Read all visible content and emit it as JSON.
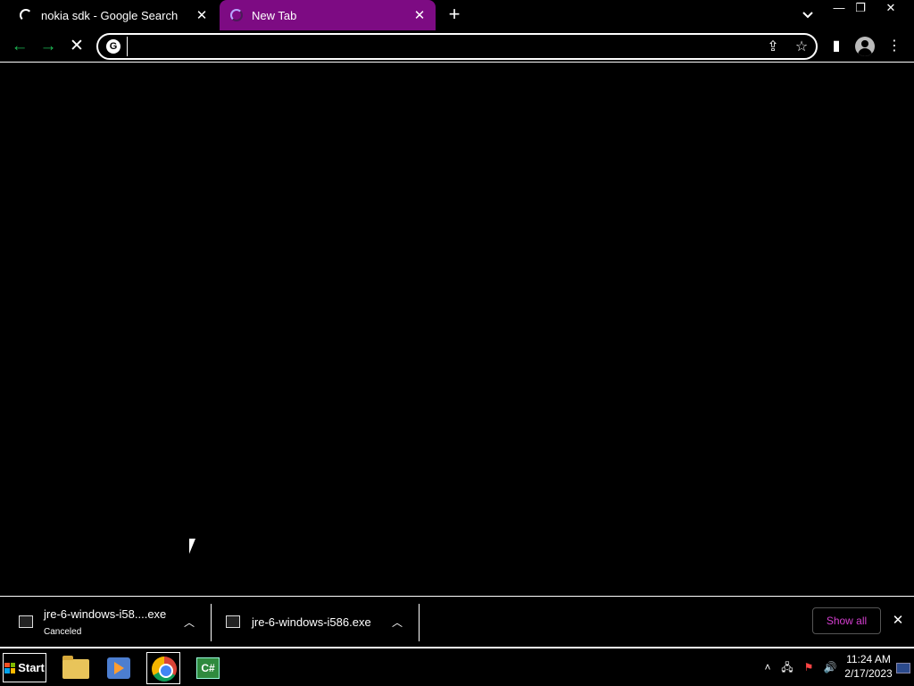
{
  "tabs": [
    {
      "title": "nokia sdk - Google Search",
      "active": false
    },
    {
      "title": "New Tab",
      "active": true
    }
  ],
  "omnibox": {
    "value": "",
    "placeholder": ""
  },
  "downloads": [
    {
      "filename": "jre-6-windows-i58....exe",
      "status": "Canceled"
    },
    {
      "filename": "jre-6-windows-i586.exe",
      "status": ""
    }
  ],
  "download_shelf": {
    "show_all_label": "Show all"
  },
  "taskbar": {
    "start_label": "Start",
    "apps": [
      "folder-icon",
      "media-player-icon",
      "chrome-icon",
      "csharp-icon"
    ],
    "clock_time": "11:24 AM",
    "clock_date": "2/17/2023",
    "csharp_label": "C#"
  },
  "colors": {
    "active_tab": "#7d0b83",
    "show_all_text": "#d63fd1",
    "back_forward_arrows": "#1db954"
  }
}
